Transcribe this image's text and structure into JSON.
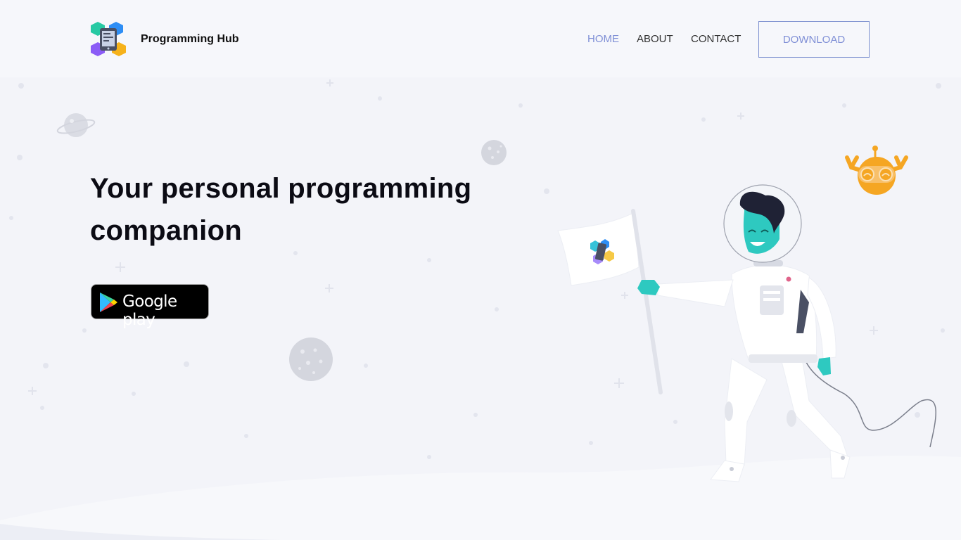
{
  "header": {
    "brand": "Programming Hub",
    "nav": [
      {
        "label": "HOME",
        "active": true
      },
      {
        "label": "ABOUT",
        "active": false
      },
      {
        "label": "CONTACT",
        "active": false
      }
    ],
    "download_label": "DOWNLOAD"
  },
  "hero": {
    "title_line1": "Your personal programming",
    "title_line2": "companion",
    "store_badge": "Google play",
    "store_icon": "google-play-icon"
  },
  "colors": {
    "background": "#f3f4f9",
    "accent": "#7f8fd6",
    "astronaut_skin": "#2ec9c0",
    "robot": "#f5a623"
  }
}
